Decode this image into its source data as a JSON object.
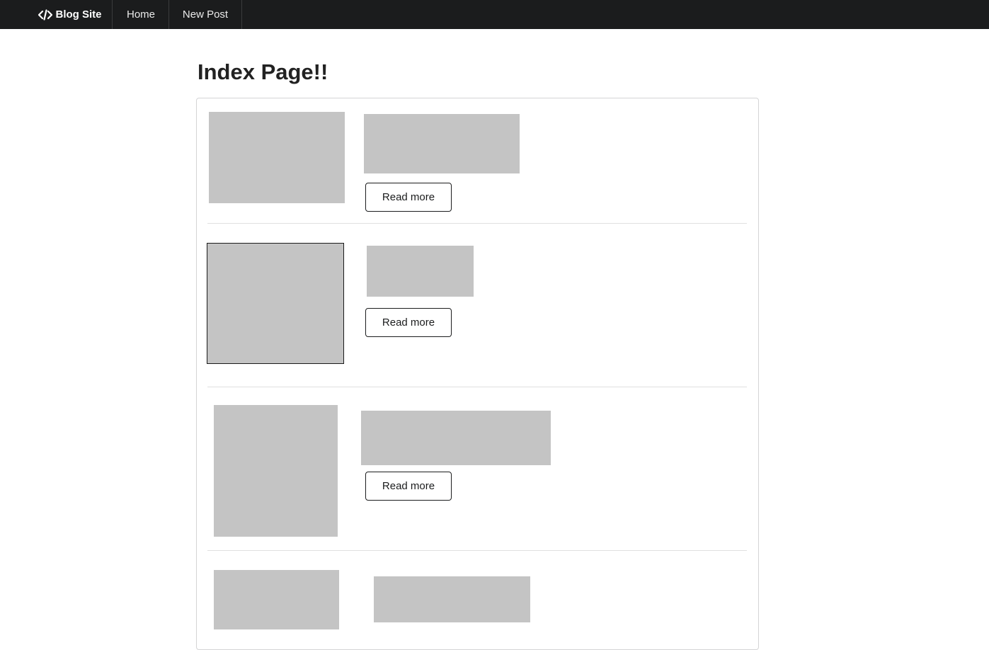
{
  "navbar": {
    "brand_label": "Blog Site",
    "brand_icon": "code-icon",
    "items": [
      {
        "label": "Home"
      },
      {
        "label": "New Post"
      }
    ]
  },
  "main": {
    "title": "Index Page!!",
    "posts": [
      {
        "button_label": "Read more"
      },
      {
        "button_label": "Read more"
      },
      {
        "button_label": "Read more"
      },
      {
        "button_label": ""
      }
    ]
  },
  "colors": {
    "navbar_bg": "#1b1c1d",
    "placeholder": "#c4c4c4",
    "divider": "#e0e0e0"
  }
}
